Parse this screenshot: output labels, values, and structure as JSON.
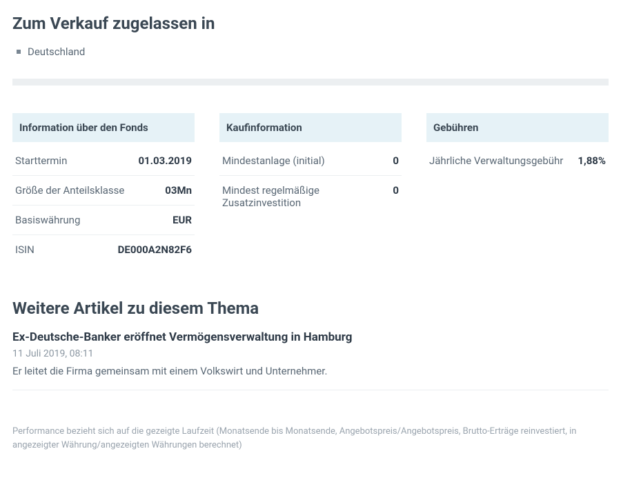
{
  "allowed": {
    "heading": "Zum Verkauf zugelassen in",
    "items": [
      "Deutschland"
    ]
  },
  "info_columns": [
    {
      "header": "Information über den Fonds",
      "rows": [
        {
          "label": "Starttermin",
          "value": "01.03.2019"
        },
        {
          "label": "Größe der Anteilsklasse",
          "value": "03Mn"
        },
        {
          "label": "Basiswährung",
          "value": "EUR"
        },
        {
          "label": "ISIN",
          "value": "DE000A2N82F6"
        }
      ]
    },
    {
      "header": "Kaufinformation",
      "rows": [
        {
          "label": "Mindestanlage (initial)",
          "value": "0"
        },
        {
          "label": "Mindest regelmäßige Zusatzinvestition",
          "value": "0"
        }
      ]
    },
    {
      "header": "Gebühren",
      "rows": [
        {
          "label": "Jährliche Verwaltungsgebühr",
          "value": "1,88%"
        }
      ]
    }
  ],
  "related": {
    "heading": "Weitere Artikel zu diesem Thema",
    "articles": [
      {
        "title": "Ex-Deutsche-Banker eröffnet Vermögensverwaltung in Hamburg",
        "date": "11 Juli 2019, 08:11",
        "summary": "Er leitet die Firma gemeinsam mit einem Volkswirt und Unternehmer."
      }
    ]
  },
  "footnote": "Performance bezieht sich auf die gezeigte Laufzeit (Monatsende bis Monatsende, Angebotspreis/Angebotspreis, Brutto-Erträge reinvestiert, in angezeigter Währung/angezeigten Währungen berechnet)"
}
